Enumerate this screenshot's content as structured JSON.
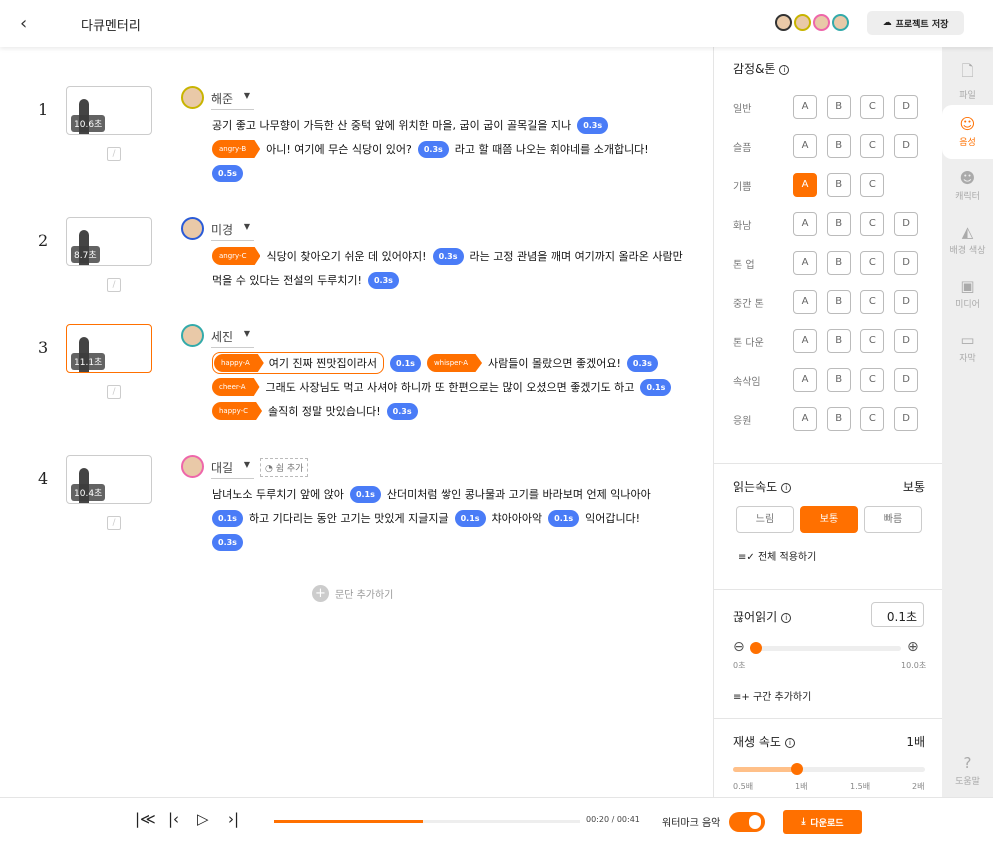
{
  "header": {
    "title": "다큐멘터리",
    "save_label": "프로젝트 저장"
  },
  "paragraphs": [
    {
      "number": "1",
      "name": "해준",
      "duration": "10.6초",
      "lines": [
        [
          {
            "type": "text",
            "text": "공기 좋고 나무향이 가득한 산 중턱 앞에 위치한 마을, 굽이 굽이 골목길을 지나"
          },
          {
            "type": "pause",
            "text": "0.3s"
          }
        ],
        [
          {
            "type": "emotion",
            "text": "angry-B"
          },
          {
            "type": "text",
            "text": "아니! 여기에 무슨 식당이 있어?"
          },
          {
            "type": "pause",
            "text": "0.3s"
          },
          {
            "type": "text",
            "text": "라고 할 때쯤 나오는 휘야네를 소개합니다!"
          }
        ],
        [
          {
            "type": "pause",
            "text": "0.5s"
          }
        ]
      ]
    },
    {
      "number": "2",
      "name": "미경",
      "duration": "8.7초",
      "lines": [
        [
          {
            "type": "emotion",
            "text": "angry-C"
          },
          {
            "type": "text",
            "text": "식당이 찾아오기 쉬운 데 있어야지!"
          },
          {
            "type": "pause",
            "text": "0.3s"
          },
          {
            "type": "text",
            "text": "라는 고정 관념을 깨며 여기까지 올라온 사람만"
          }
        ],
        [
          {
            "type": "text",
            "text": "먹을 수 있다는 전설의 두루치기!"
          },
          {
            "type": "pause",
            "text": "0.3s"
          }
        ]
      ]
    },
    {
      "number": "3",
      "name": "세진",
      "duration": "11.1초",
      "selected": true,
      "lines": [
        [
          {
            "type": "emotion",
            "text": "happy-A",
            "selected": true
          },
          {
            "type": "text",
            "text": "여기 진짜 찐맛집이라서",
            "selected": true
          },
          {
            "type": "pause",
            "text": "0.1s"
          },
          {
            "type": "emotion",
            "text": "whisper-A"
          },
          {
            "type": "text",
            "text": "사람들이 몰랐으면 좋겠어요!"
          },
          {
            "type": "pause",
            "text": "0.3s"
          }
        ],
        [
          {
            "type": "emotion",
            "text": "cheer-A"
          },
          {
            "type": "text",
            "text": "그래도 사장님도 먹고 사셔야 하니까 또 한편으로는 많이 오셨으면 좋겠기도 하고"
          },
          {
            "type": "pause",
            "text": "0.1s"
          }
        ],
        [
          {
            "type": "emotion",
            "text": "happy-C"
          },
          {
            "type": "text",
            "text": "솔직히 정말 맛있습니다!"
          },
          {
            "type": "pause",
            "text": "0.3s"
          }
        ]
      ]
    },
    {
      "number": "4",
      "name": "대길",
      "duration": "10.4초",
      "rest_label": "쉼 추가",
      "lines": [
        [
          {
            "type": "text",
            "text": "남녀노소 두루치기 앞에 앉아"
          },
          {
            "type": "pause",
            "text": "0.1s"
          },
          {
            "type": "text",
            "text": "산더미처럼 쌓인 콩나물과 고기를 바라보며 언제 익나아아"
          }
        ],
        [
          {
            "type": "pause",
            "text": "0.1s"
          },
          {
            "type": "text",
            "text": "하고 기다리는 동안 고기는 맛있게 지글지글"
          },
          {
            "type": "pause",
            "text": "0.1s"
          },
          {
            "type": "text",
            "text": "챠아아아악"
          },
          {
            "type": "pause",
            "text": "0.1s"
          },
          {
            "type": "text",
            "text": "익어갑니다!"
          }
        ],
        [
          {
            "type": "pause",
            "text": "0.3s"
          }
        ]
      ]
    }
  ],
  "add_paragraph": "문단 추가하기",
  "emotion": {
    "title": "감정&톤",
    "rows": [
      {
        "label": "일반",
        "options": [
          "A",
          "B",
          "C",
          "D"
        ]
      },
      {
        "label": "슬픔",
        "options": [
          "A",
          "B",
          "C",
          "D"
        ]
      },
      {
        "label": "기쁨",
        "options": [
          "A",
          "B",
          "C"
        ],
        "selected": "A"
      },
      {
        "label": "화남",
        "options": [
          "A",
          "B",
          "C",
          "D"
        ]
      },
      {
        "label": "톤 업",
        "options": [
          "A",
          "B",
          "C",
          "D"
        ]
      },
      {
        "label": "중간 톤",
        "options": [
          "A",
          "B",
          "C",
          "D"
        ]
      },
      {
        "label": "톤 다운",
        "options": [
          "A",
          "B",
          "C",
          "D"
        ]
      },
      {
        "label": "속삭임",
        "options": [
          "A",
          "B",
          "C",
          "D"
        ]
      },
      {
        "label": "응원",
        "options": [
          "A",
          "B",
          "C",
          "D"
        ]
      }
    ]
  },
  "reading_speed": {
    "title": "읽는속도",
    "value": "보통",
    "options": [
      "느림",
      "보통",
      "빠름"
    ],
    "apply_all": "전체 적용하기"
  },
  "pause_reading": {
    "title": "끊어읽기",
    "value": "0.1초",
    "min": "0초",
    "max": "10.0초",
    "fraction": 0.01,
    "add_section": "구간 추가하기"
  },
  "playback_speed": {
    "title": "재생 속도",
    "value": "1배",
    "ticks": [
      "0.5배",
      "1배",
      "1.5배",
      "2배"
    ],
    "fraction": 0.333
  },
  "tabs": [
    {
      "icon": "file-icon",
      "label": "파일"
    },
    {
      "icon": "voice-icon",
      "label": "음성",
      "active": true
    },
    {
      "icon": "character-icon",
      "label": "캐릭터"
    },
    {
      "icon": "paint-bucket-icon",
      "label": "배경 색상"
    },
    {
      "icon": "media-icon",
      "label": "미디어"
    },
    {
      "icon": "subtitle-icon",
      "label": "자막"
    },
    {
      "icon": "help-icon",
      "label": "도움말"
    }
  ],
  "player": {
    "time": "00:20 / 00:41",
    "progress": 0.486,
    "watermark_label": "워터마크 음악",
    "watermark_on": true,
    "download_label": "다운로드"
  },
  "colors": {
    "accent": "#ff7000",
    "pause": "#4a7cf7"
  }
}
